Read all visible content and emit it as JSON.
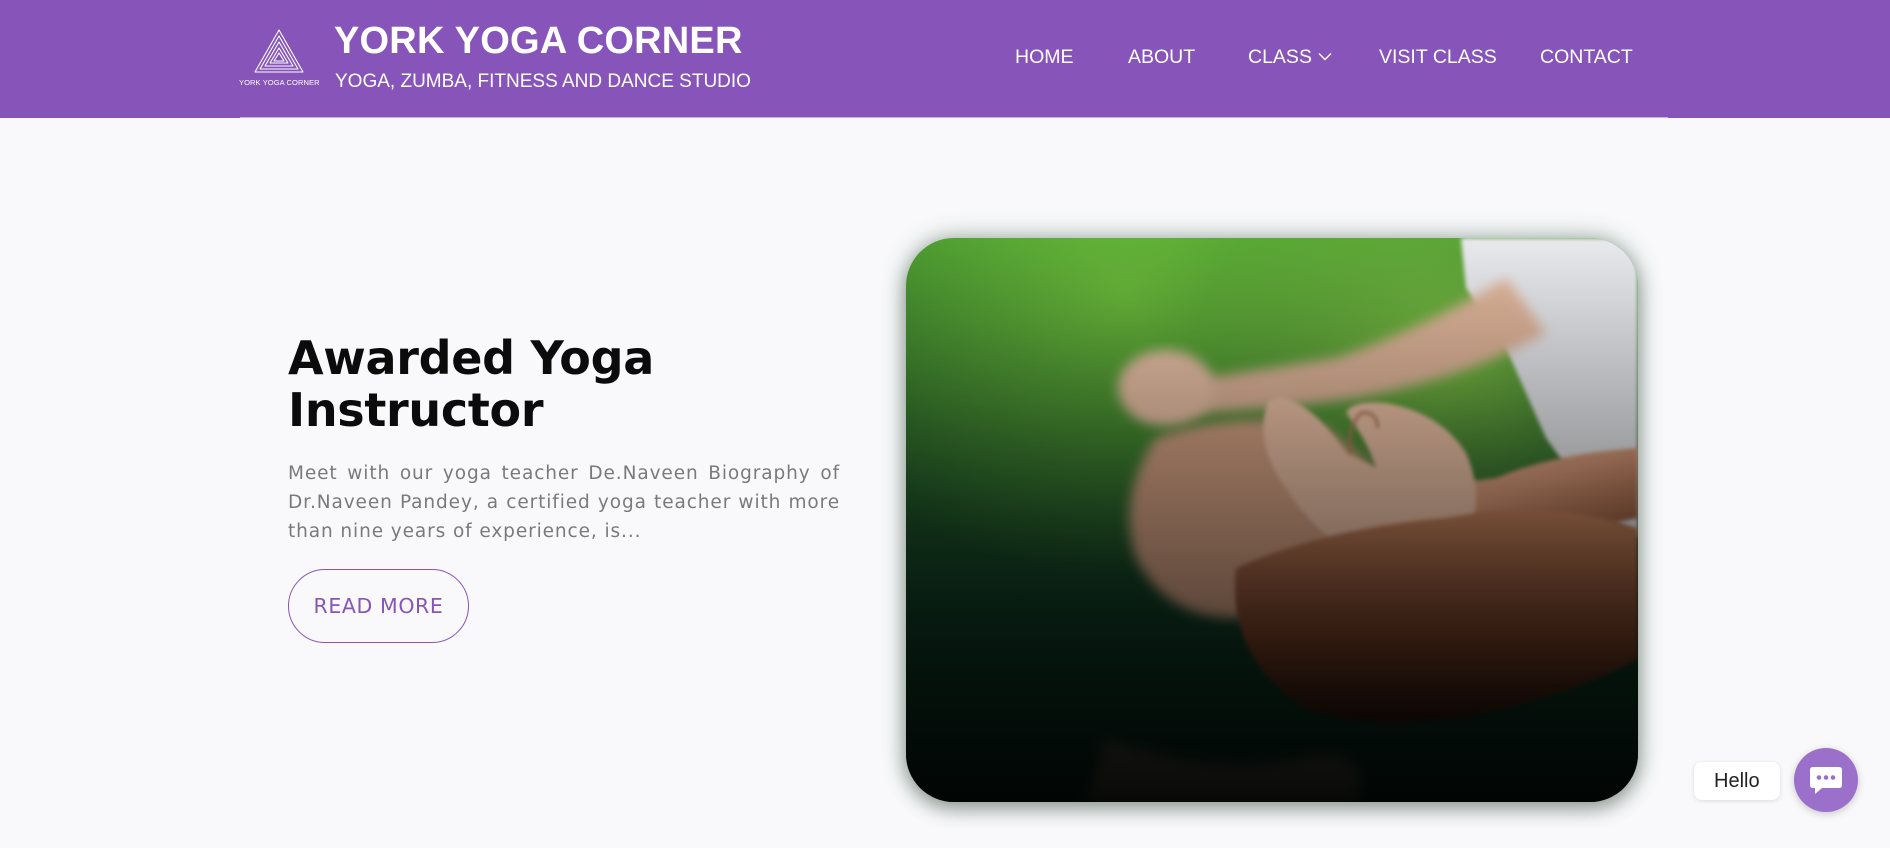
{
  "header": {
    "logo_text": "YORK YOGA CORNER",
    "title": "YORK YOGA CORNER",
    "subtitle": "YOGA, ZUMBA, FITNESS AND DANCE STUDIO",
    "background_color": "#8755b9",
    "nav": [
      {
        "label": "HOME"
      },
      {
        "label": "ABOUT"
      },
      {
        "label": "CLASS",
        "icon": "chevron-down-icon"
      },
      {
        "label": "VISIT CLASS"
      },
      {
        "label": "CONTACT"
      }
    ]
  },
  "hero": {
    "title": "Awarded Yoga Instructor",
    "text": "Meet with our yoga teacher De.Naveen Biography of Dr.Naveen Pandey, a certified yoga teacher with more than nine years of experience, is...",
    "button_label": "READ MORE",
    "accent_color": "#8656b6",
    "image_subject": "meditation-hands-image"
  },
  "chat": {
    "bubble_text": "Hello",
    "icon": "chat-icon",
    "button_color": "#9a70cb"
  }
}
